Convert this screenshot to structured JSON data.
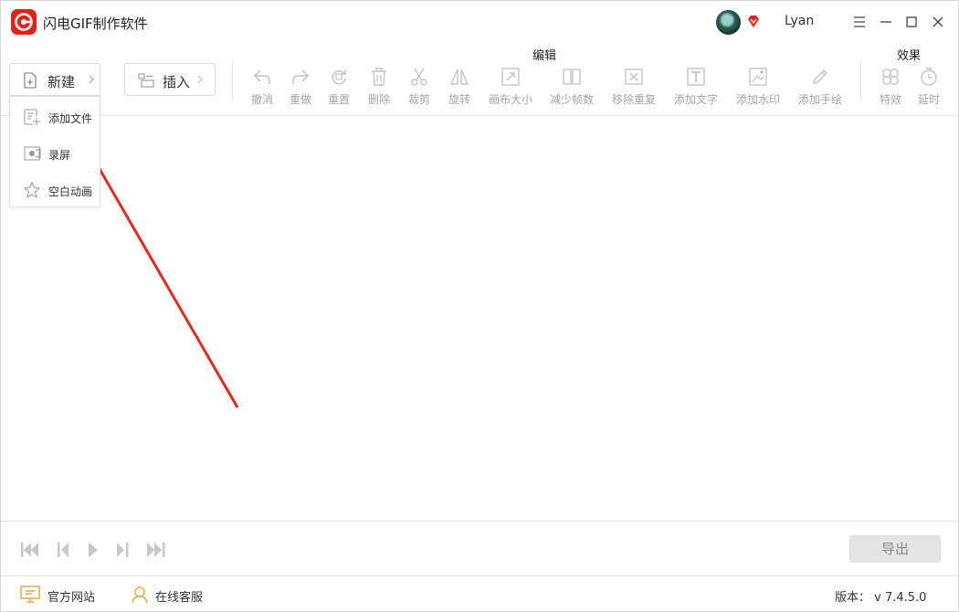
{
  "app": {
    "title": "闪电GIF制作软件",
    "brand_color": "#e2231a"
  },
  "user": {
    "name": "Lyan",
    "vip_color": "#e2231a"
  },
  "toolbar": {
    "new_label": "新建",
    "insert_label": "插入",
    "edit_group_label": "编辑",
    "effect_group_label": "效果",
    "edit_tools": [
      "撤消",
      "重做",
      "重置",
      "删除",
      "裁剪",
      "旋转",
      "画布大小",
      "减少帧数",
      "移除重复",
      "添加文字",
      "添加水印",
      "添加手绘"
    ],
    "effect_tools": [
      "特效",
      "延时"
    ],
    "disabled_color": "#a6a6a6"
  },
  "dropdown": {
    "items": [
      "添加文件",
      "录屏",
      "空白动画"
    ]
  },
  "annotation": {
    "arrow_color": "#e8291c"
  },
  "playback": {
    "export_label": "导出"
  },
  "footer": {
    "website_label": "官方网站",
    "support_label": "在线客服",
    "version_text": "版本：  v 7.4.5.0",
    "icon_color": "#e7a94e"
  }
}
